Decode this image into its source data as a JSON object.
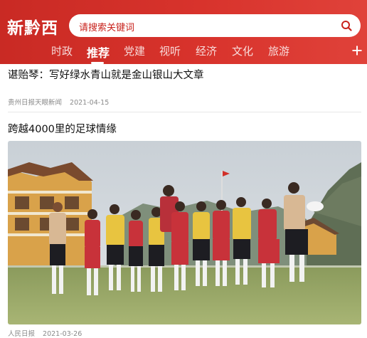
{
  "app": {
    "title": "新黔西"
  },
  "search": {
    "placeholder": "请搜索关键词"
  },
  "tabs": [
    {
      "label": "时政",
      "active": false
    },
    {
      "label": "推荐",
      "active": true
    },
    {
      "label": "党建",
      "active": false
    },
    {
      "label": "视听",
      "active": false
    },
    {
      "label": "经济",
      "active": false
    },
    {
      "label": "文化",
      "active": false
    },
    {
      "label": "旅游",
      "active": false
    }
  ],
  "articles": [
    {
      "title": "谌贻琴：写好绿水青山就是金山银山大文章",
      "source": "贵州日报天眼新闻",
      "date": "2021-04-15"
    },
    {
      "title": "跨越4000里的足球情缘",
      "source": "人民日报",
      "date": "2021-03-26",
      "image": "children-football-team-photo"
    }
  ],
  "colors": {
    "brand": "#d12f28",
    "search_text": "#c8221c"
  },
  "icons": {
    "search": "search-icon",
    "add_channel": "plus-icon"
  }
}
